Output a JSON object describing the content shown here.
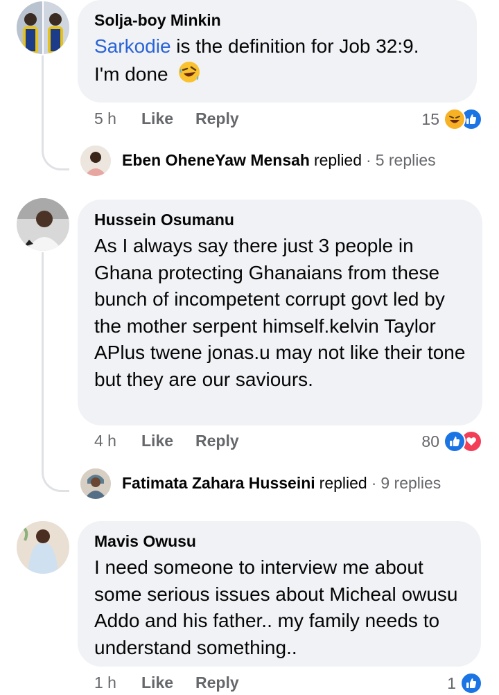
{
  "comments": [
    {
      "author": "Solja-boy Minkin",
      "mention": "Sarkodie",
      "text_after_mention": " is the definition for Job 32:9.",
      "text_line2": "I'm done",
      "emoji": "rolling-on-floor-laughing",
      "time": "5 h",
      "like_label": "Like",
      "reply_label": "Reply",
      "reaction_count": "15",
      "reactions": [
        "haha",
        "like"
      ],
      "reply_preview": {
        "name": "Eben OheneYaw Mensah",
        "verb": "replied",
        "dot": "·",
        "count": "5 replies"
      }
    },
    {
      "author": "Hussein Osumanu",
      "text": "As I always say there just 3 people in Ghana protecting Ghanaians from these bunch of incompetent corrupt govt led by the mother serpent himself.kelvin Taylor APlus twene jonas.u may not like their tone but they are our saviours.",
      "time": "4 h",
      "like_label": "Like",
      "reply_label": "Reply",
      "reaction_count": "80",
      "reactions": [
        "like",
        "love"
      ],
      "reply_preview": {
        "name": "Fatimata Zahara Husseini",
        "verb": "replied",
        "dot": "·",
        "count": "9 replies"
      }
    },
    {
      "author": "Mavis Owusu",
      "text": "I need someone to interview me about some serious issues  about Micheal owusu Addo and his father..  my family needs to understand something..",
      "time": "1 h",
      "like_label": "Like",
      "reply_label": "Reply",
      "reaction_count": "1",
      "reactions": [
        "like"
      ]
    }
  ],
  "colors": {
    "bubble": "#f0f2f5",
    "meta": "#65676b",
    "mention": "#2a63d6",
    "like": "#1b74e4",
    "love": "#f33e58",
    "haha": "#f7b125"
  }
}
